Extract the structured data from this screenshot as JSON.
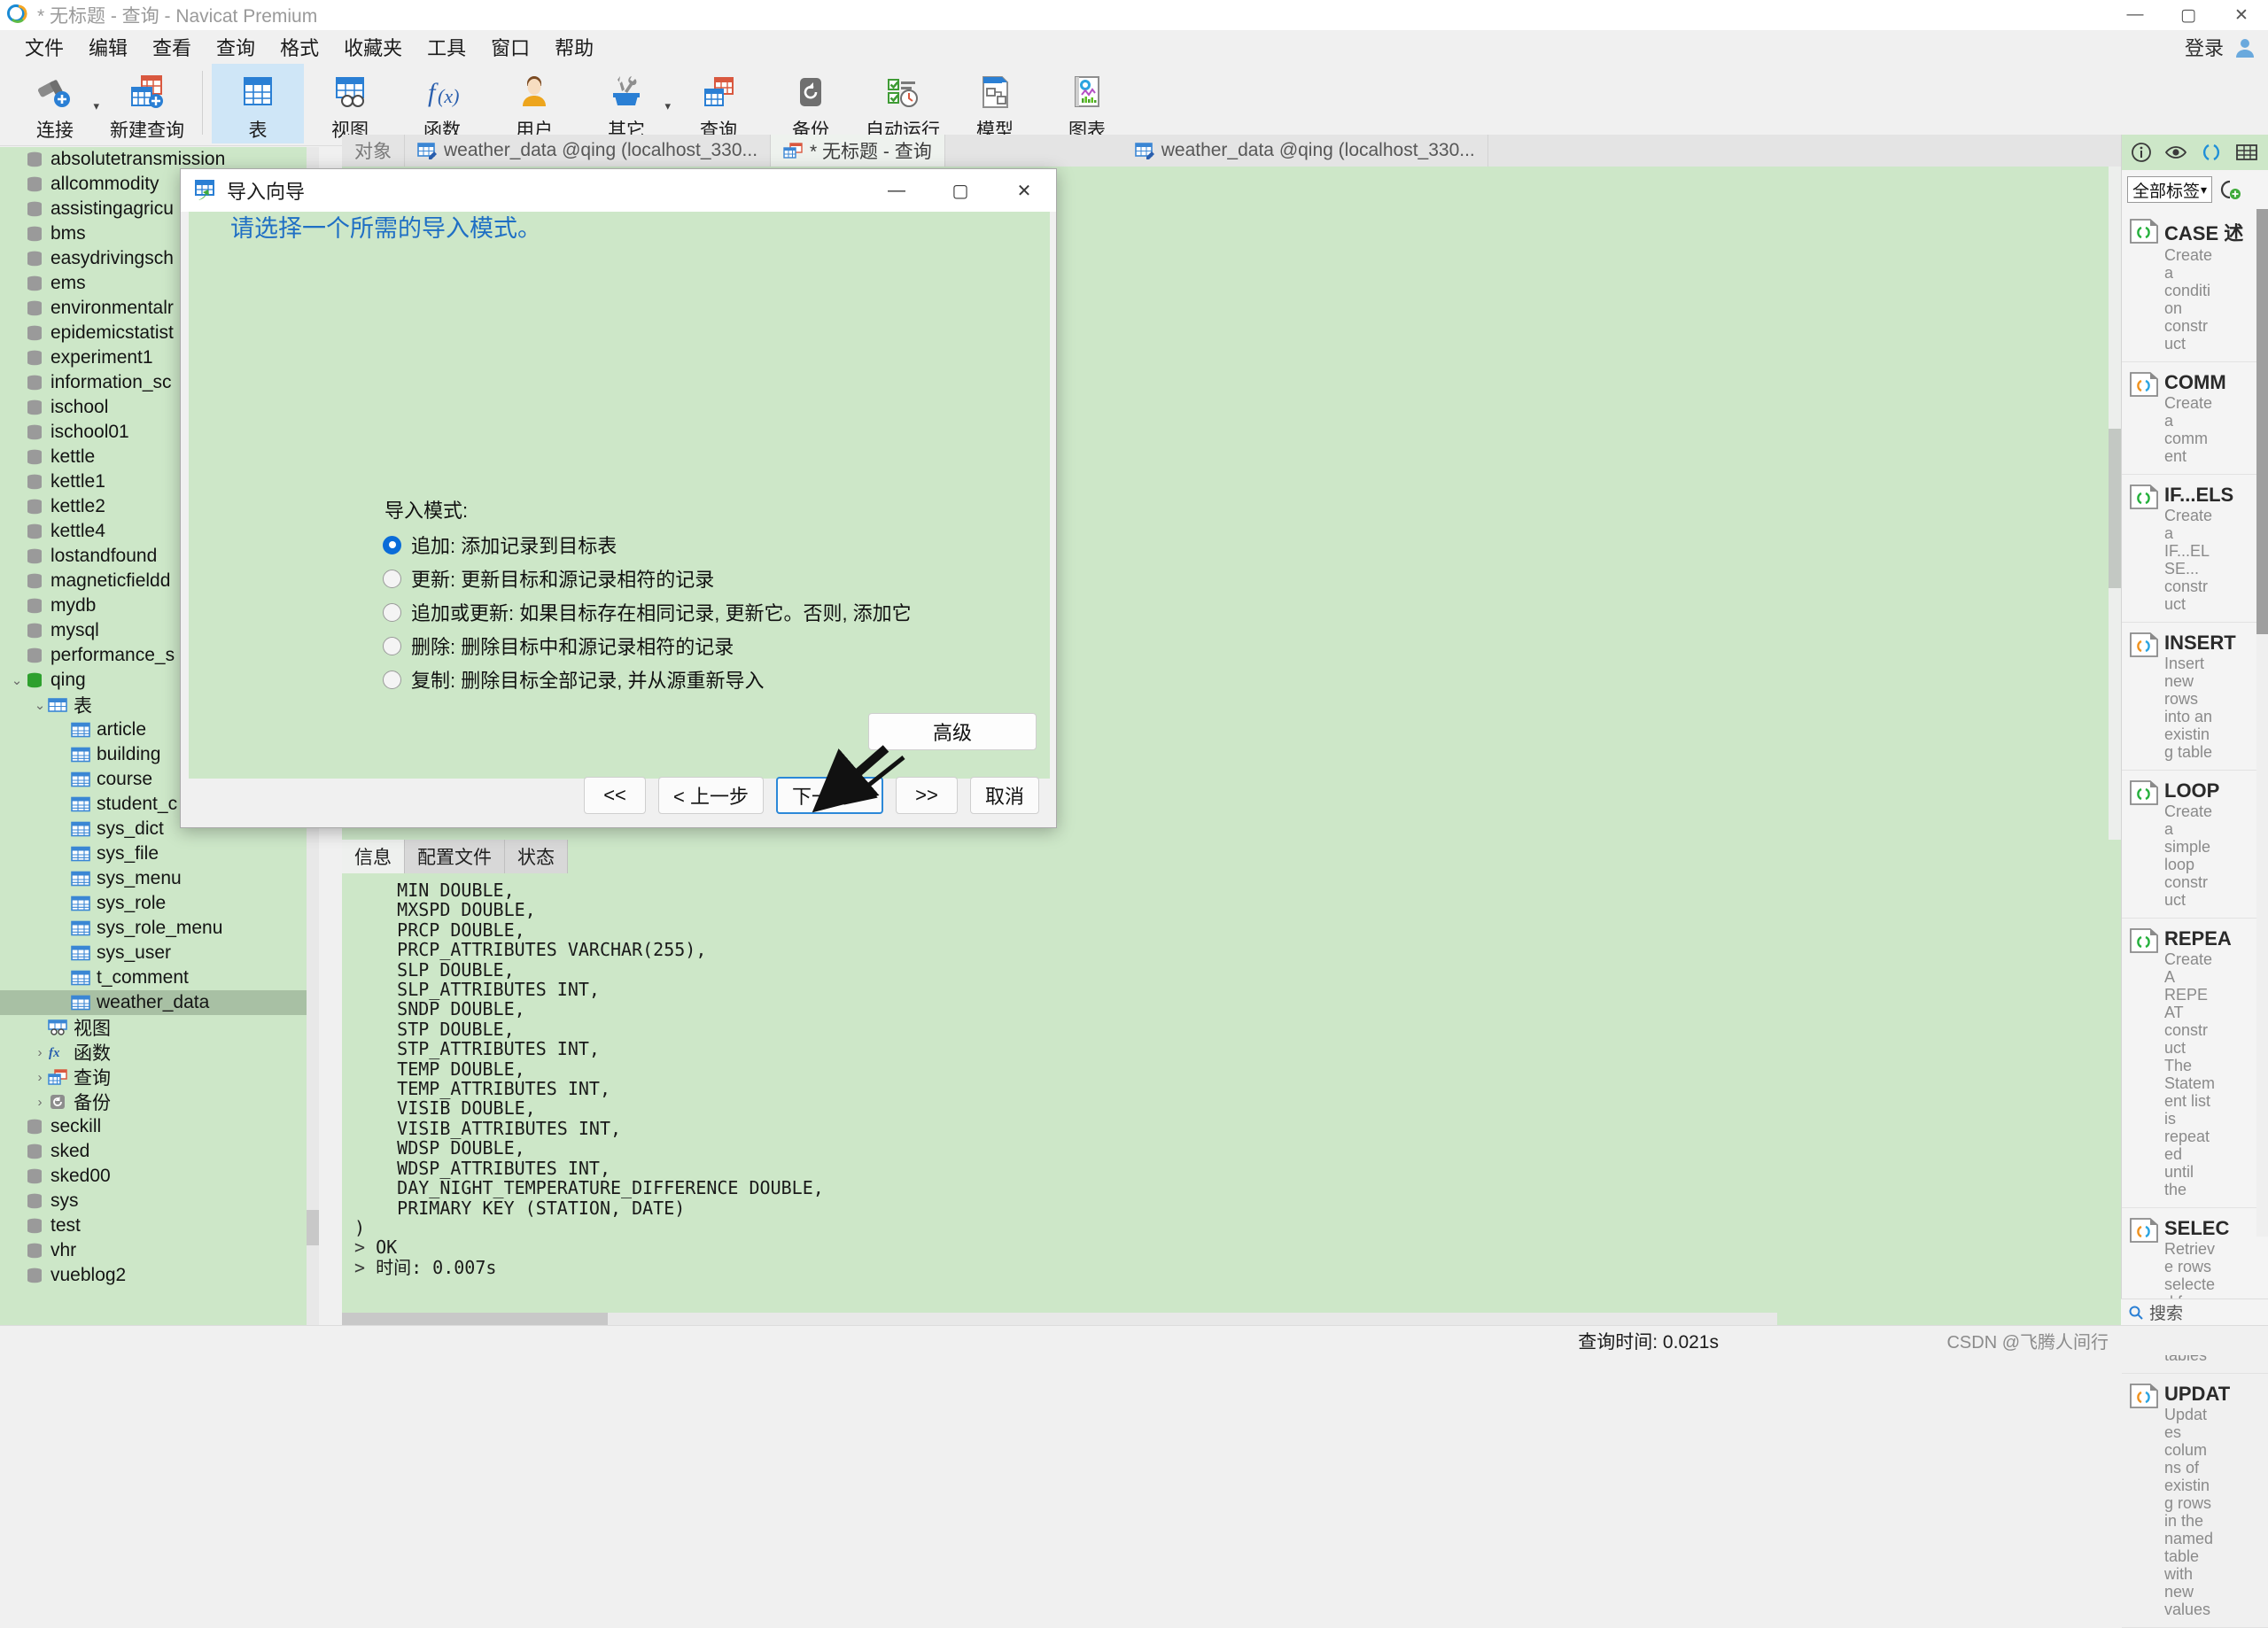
{
  "window": {
    "title": "* 无标题 - 查询 - Navicat Premium",
    "minimize": "—",
    "maximize": "▢",
    "close": "✕"
  },
  "menubar": {
    "items": [
      "文件",
      "编辑",
      "查看",
      "查询",
      "格式",
      "收藏夹",
      "工具",
      "窗口",
      "帮助"
    ],
    "login_label": "登录"
  },
  "toolbar": {
    "items": [
      {
        "label": "连接",
        "icon": "connection-icon",
        "has_caret": true
      },
      {
        "label": "新建查询",
        "icon": "new-query-icon",
        "has_caret": false
      },
      {
        "label": "表",
        "icon": "table-icon",
        "has_caret": false,
        "selected": true
      },
      {
        "label": "视图",
        "icon": "view-icon",
        "has_caret": false
      },
      {
        "label": "函数",
        "icon": "function-icon",
        "has_caret": false
      },
      {
        "label": "用户",
        "icon": "user-icon",
        "has_caret": false
      },
      {
        "label": "其它",
        "icon": "other-tools-icon",
        "has_caret": true
      },
      {
        "label": "查询",
        "icon": "query-icon",
        "has_caret": false
      },
      {
        "label": "备份",
        "icon": "backup-icon",
        "has_caret": false
      },
      {
        "label": "自动运行",
        "icon": "automation-icon",
        "has_caret": false
      },
      {
        "label": "模型",
        "icon": "model-icon",
        "has_caret": false
      },
      {
        "label": "图表",
        "icon": "chart-icon",
        "has_caret": false
      }
    ]
  },
  "sidebar": {
    "items": [
      {
        "label": "absolutetransmission",
        "indent": 0,
        "icon": "database-icon",
        "twisty": "",
        "selected": false
      },
      {
        "label": "allcommodity",
        "indent": 0,
        "icon": "database-icon",
        "twisty": "",
        "selected": false
      },
      {
        "label": "assistingagricu",
        "indent": 0,
        "icon": "database-icon",
        "twisty": "",
        "selected": false
      },
      {
        "label": "bms",
        "indent": 0,
        "icon": "database-icon",
        "twisty": "",
        "selected": false
      },
      {
        "label": "easydrivingsch",
        "indent": 0,
        "icon": "database-icon",
        "twisty": "",
        "selected": false
      },
      {
        "label": "ems",
        "indent": 0,
        "icon": "database-icon",
        "twisty": "",
        "selected": false
      },
      {
        "label": "environmentalr",
        "indent": 0,
        "icon": "database-icon",
        "twisty": "",
        "selected": false
      },
      {
        "label": "epidemicstatist",
        "indent": 0,
        "icon": "database-icon",
        "twisty": "",
        "selected": false
      },
      {
        "label": "experiment1",
        "indent": 0,
        "icon": "database-icon",
        "twisty": "",
        "selected": false
      },
      {
        "label": "information_sc",
        "indent": 0,
        "icon": "database-icon",
        "twisty": "",
        "selected": false
      },
      {
        "label": "ischool",
        "indent": 0,
        "icon": "database-icon",
        "twisty": "",
        "selected": false
      },
      {
        "label": "ischool01",
        "indent": 0,
        "icon": "database-icon",
        "twisty": "",
        "selected": false
      },
      {
        "label": "kettle",
        "indent": 0,
        "icon": "database-icon",
        "twisty": "",
        "selected": false
      },
      {
        "label": "kettle1",
        "indent": 0,
        "icon": "database-icon",
        "twisty": "",
        "selected": false
      },
      {
        "label": "kettle2",
        "indent": 0,
        "icon": "database-icon",
        "twisty": "",
        "selected": false
      },
      {
        "label": "kettle4",
        "indent": 0,
        "icon": "database-icon",
        "twisty": "",
        "selected": false
      },
      {
        "label": "lostandfound",
        "indent": 0,
        "icon": "database-icon",
        "twisty": "",
        "selected": false
      },
      {
        "label": "magneticfieldd",
        "indent": 0,
        "icon": "database-icon",
        "twisty": "",
        "selected": false
      },
      {
        "label": "mydb",
        "indent": 0,
        "icon": "database-icon",
        "twisty": "",
        "selected": false
      },
      {
        "label": "mysql",
        "indent": 0,
        "icon": "database-icon",
        "twisty": "",
        "selected": false
      },
      {
        "label": "performance_s",
        "indent": 0,
        "icon": "database-icon",
        "twisty": "",
        "selected": false
      },
      {
        "label": "qing",
        "indent": 0,
        "icon": "database-open-icon",
        "twisty": "v",
        "selected": false
      },
      {
        "label": "表",
        "indent": 1,
        "icon": "tables-folder-icon",
        "twisty": "v",
        "selected": false
      },
      {
        "label": "article",
        "indent": 2,
        "icon": "table-item-icon",
        "twisty": "",
        "selected": false
      },
      {
        "label": "building",
        "indent": 2,
        "icon": "table-item-icon",
        "twisty": "",
        "selected": false
      },
      {
        "label": "course",
        "indent": 2,
        "icon": "table-item-icon",
        "twisty": "",
        "selected": false
      },
      {
        "label": "student_c",
        "indent": 2,
        "icon": "table-item-icon",
        "twisty": "",
        "selected": false
      },
      {
        "label": "sys_dict",
        "indent": 2,
        "icon": "table-item-icon",
        "twisty": "",
        "selected": false
      },
      {
        "label": "sys_file",
        "indent": 2,
        "icon": "table-item-icon",
        "twisty": "",
        "selected": false
      },
      {
        "label": "sys_menu",
        "indent": 2,
        "icon": "table-item-icon",
        "twisty": "",
        "selected": false
      },
      {
        "label": "sys_role",
        "indent": 2,
        "icon": "table-item-icon",
        "twisty": "",
        "selected": false
      },
      {
        "label": "sys_role_menu",
        "indent": 2,
        "icon": "table-item-icon",
        "twisty": "",
        "selected": false
      },
      {
        "label": "sys_user",
        "indent": 2,
        "icon": "table-item-icon",
        "twisty": "",
        "selected": false
      },
      {
        "label": "t_comment",
        "indent": 2,
        "icon": "table-item-icon",
        "twisty": "",
        "selected": false
      },
      {
        "label": "weather_data",
        "indent": 2,
        "icon": "table-item-icon",
        "twisty": "",
        "selected": true
      },
      {
        "label": "视图",
        "indent": 1,
        "icon": "views-folder-icon",
        "twisty": "",
        "selected": false
      },
      {
        "label": "函数",
        "indent": 1,
        "icon": "functions-folder-icon",
        "twisty": ">",
        "selected": false
      },
      {
        "label": "查询",
        "indent": 1,
        "icon": "queries-folder-icon",
        "twisty": ">",
        "selected": false
      },
      {
        "label": "备份",
        "indent": 1,
        "icon": "backups-folder-icon",
        "twisty": ">",
        "selected": false
      },
      {
        "label": "seckill",
        "indent": 0,
        "icon": "database-icon",
        "twisty": "",
        "selected": false
      },
      {
        "label": "sked",
        "indent": 0,
        "icon": "database-icon",
        "twisty": "",
        "selected": false
      },
      {
        "label": "sked00",
        "indent": 0,
        "icon": "database-icon",
        "twisty": "",
        "selected": false
      },
      {
        "label": "sys",
        "indent": 0,
        "icon": "database-icon",
        "twisty": "",
        "selected": false
      },
      {
        "label": "test",
        "indent": 0,
        "icon": "database-icon",
        "twisty": "",
        "selected": false
      },
      {
        "label": "vhr",
        "indent": 0,
        "icon": "database-icon",
        "twisty": "",
        "selected": false
      },
      {
        "label": "vueblog2",
        "indent": 0,
        "icon": "database-icon",
        "twisty": "",
        "selected": false
      }
    ]
  },
  "tabstrip": {
    "tabs": [
      {
        "label": "对象",
        "icon": "",
        "active": false
      },
      {
        "label": "weather_data @qing (localhost_330...",
        "icon": "table-designer-icon",
        "active": false
      },
      {
        "label": "* 无标题 - 查询",
        "icon": "query-tab-icon",
        "active": true
      },
      {
        "label": "weather_data @qing (localhost_330...",
        "icon": "table-designer-icon",
        "active": false
      }
    ]
  },
  "result_panel": {
    "tabs": [
      "信息",
      "配置文件",
      "状态"
    ],
    "active_tab": "信息",
    "log_lines": [
      "    MIN DOUBLE,",
      "    MXSPD DOUBLE,",
      "    PRCP DOUBLE,",
      "    PRCP_ATTRIBUTES VARCHAR(255),",
      "    SLP DOUBLE,",
      "    SLP_ATTRIBUTES INT,",
      "    SNDP DOUBLE,",
      "    STP DOUBLE,",
      "    STP_ATTRIBUTES INT,",
      "    TEMP DOUBLE,",
      "    TEMP_ATTRIBUTES INT,",
      "    VISIB DOUBLE,",
      "    VISIB_ATTRIBUTES INT,",
      "    WDSP DOUBLE,",
      "    WDSP_ATTRIBUTES INT,",
      "    DAY_NIGHT_TEMPERATURE_DIFFERENCE DOUBLE,",
      "    PRIMARY KEY (STATION, DATE)",
      ")",
      "> OK",
      "> 时间: 0.007s"
    ]
  },
  "editor": {
    "visible_line": "PRIMARY KEY (STATION, DATE)"
  },
  "right_panel": {
    "icons": [
      "info-icon",
      "eye-icon",
      "code-brackets-icon",
      "grid-icon"
    ],
    "filter_value": "全部标签",
    "add_snippet_label": "add-snippet-icon",
    "search_placeholder": "搜索",
    "snippets": [
      {
        "title": "CASE 述",
        "desc": "Create a condition construct",
        "icon_color": "green"
      },
      {
        "title": "COMM",
        "desc": "Create a comment",
        "icon_color": "orange"
      },
      {
        "title": "IF...ELS",
        "desc": "Create a IF...ELSE... construct",
        "icon_color": "green"
      },
      {
        "title": "INSERT",
        "desc": "Insert new rows into an existing table",
        "icon_color": "orange"
      },
      {
        "title": "LOOP",
        "desc": "Create a simple loop construct",
        "icon_color": "green"
      },
      {
        "title": "REPEA",
        "desc": "Create A REPEAT construct The Statement list is repeated until the",
        "icon_color": "green"
      },
      {
        "title": "SELEC",
        "desc": "Retrieve rows selected from one or more tables",
        "icon_color": "orange"
      },
      {
        "title": "UPDAT",
        "desc": "Updates columns of existing rows in the named table with new values",
        "icon_color": "orange"
      }
    ]
  },
  "statusbar": {
    "query_time": "查询时间: 0.021s",
    "watermark": "CSDN @飞腾人间行"
  },
  "dialog": {
    "title": "导入向导",
    "minimize": "—",
    "maximize": "▢",
    "close": "✕",
    "heading": "请选择一个所需的导入模式。",
    "modes_label": "导入模式:",
    "modes": [
      {
        "label": "追加: 添加记录到目标表",
        "selected": true
      },
      {
        "label": "更新: 更新目标和源记录相符的记录",
        "selected": false
      },
      {
        "label": "追加或更新: 如果目标存在相同记录, 更新它。否则, 添加它",
        "selected": false
      },
      {
        "label": "删除: 删除目标中和源记录相符的记录",
        "selected": false
      },
      {
        "label": "复制: 删除目标全部记录, 并从源重新导入",
        "selected": false
      }
    ],
    "advanced_label": "高级",
    "buttons": [
      {
        "label": "<<",
        "focus": false
      },
      {
        "label": "< 上一步",
        "focus": false
      },
      {
        "label": "下一步 >",
        "focus": true
      },
      {
        "label": ">>",
        "focus": false
      },
      {
        "label": "取消",
        "focus": false
      }
    ]
  },
  "colors": {
    "panel_green": "#cde7c8",
    "accent_blue": "#1f6fc4",
    "selection": "#a8c0a4",
    "toolbar_selected": "#cfe6f7"
  }
}
